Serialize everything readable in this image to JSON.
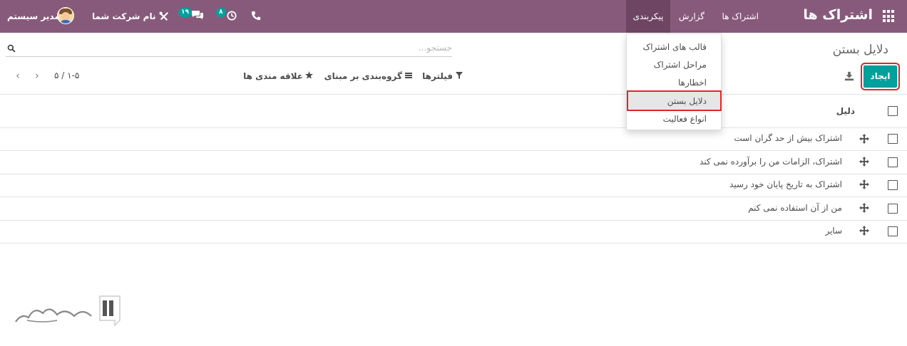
{
  "navbar": {
    "app_title": "اشتراک ها",
    "menus": [
      "اشتراک ها",
      "گزارش",
      "پیکربندی"
    ],
    "phone_icon": "phone-icon",
    "activity_count": "۸",
    "messages_count": "۱۹",
    "company_name": "نام شرکت شما",
    "user_name": "مدیر سیستم"
  },
  "config_menu": {
    "items": [
      "قالب های اشتراک",
      "مراحل اشتراک",
      "اخطارها",
      "دلایل بستن",
      "انواع فعالیت"
    ],
    "highlighted": "دلایل بستن"
  },
  "control_panel": {
    "breadcrumb": "دلایل بستن",
    "create_label": "ایجاد",
    "search_placeholder": "جستجو...",
    "filters_label": "فیلترها",
    "groupby_label": "گروه‌بندی بر مبنای",
    "favorites_label": "علاقه مندی ها",
    "pager": "۱-۵ / ۵"
  },
  "list": {
    "column_header": "دلیل",
    "rows": [
      "اشتراک بیش از حد گران است",
      "اشتراک، الزامات من را برآورده نمی کند",
      "اشتراک به تاریخ پایان خود رسید",
      "من از آن استفاده نمی کنم",
      "سایر"
    ]
  },
  "colors": {
    "navbar": "#875a7b",
    "primary_button": "#00a09d",
    "highlight_border": "#e0262d"
  }
}
